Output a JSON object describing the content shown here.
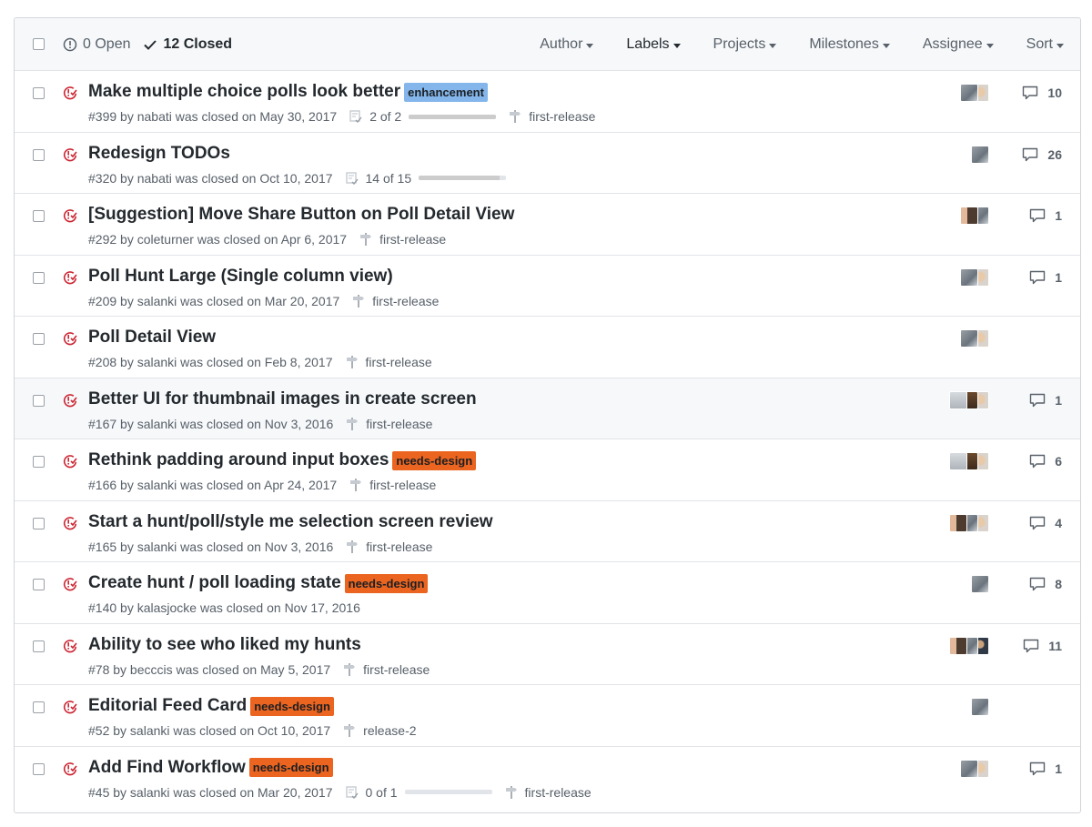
{
  "header": {
    "open_label": "0 Open",
    "closed_label": "12 Closed",
    "filters": [
      "Author",
      "Labels",
      "Projects",
      "Milestones",
      "Assignee",
      "Sort"
    ]
  },
  "colors": {
    "closed_icon": "#cb2431",
    "label_enhancement": "#84b6eb",
    "label_needs_design": "#eb6420"
  },
  "issues": [
    {
      "title": "Make multiple choice polls look better",
      "label": "enhancement",
      "meta": "#399 by nabati was closed on May 30, 2017",
      "tasks": "2 of 2",
      "task_progress": 1.0,
      "milestone": "first-release",
      "comments": "10",
      "avatars": [
        "avatar-gray",
        "avatar-glasses"
      ]
    },
    {
      "title": "Redesign TODOs",
      "label": "",
      "meta": "#320 by nabati was closed on Oct 10, 2017",
      "tasks": "14 of 15",
      "task_progress": 0.93,
      "milestone": "",
      "comments": "26",
      "avatars": [
        "avatar-gray"
      ]
    },
    {
      "title": "[Suggestion] Move Share Button on Poll Detail View",
      "label": "",
      "meta": "#292 by coleturner was closed on Apr 6, 2017",
      "tasks": "",
      "task_progress": 0,
      "milestone": "first-release",
      "comments": "1",
      "avatars": [
        "avatar-face",
        "avatar-gray"
      ]
    },
    {
      "title": "Poll Hunt Large (Single column view)",
      "label": "",
      "meta": "#209 by salanki was closed on Mar 20, 2017",
      "tasks": "",
      "task_progress": 0,
      "milestone": "first-release",
      "comments": "1",
      "avatars": [
        "avatar-gray",
        "avatar-glasses"
      ]
    },
    {
      "title": "Poll Detail View",
      "label": "",
      "meta": "#208 by salanki was closed on Feb 8, 2017",
      "tasks": "",
      "task_progress": 0,
      "milestone": "first-release",
      "comments": "",
      "avatars": [
        "avatar-gray",
        "avatar-glasses"
      ]
    },
    {
      "title": "Better UI for thumbnail images in create screen",
      "label": "",
      "meta": "#167 by salanki was closed on Nov 3, 2016",
      "tasks": "",
      "task_progress": 0,
      "milestone": "first-release",
      "comments": "1",
      "avatars": [
        "avatar-light",
        "avatar-brown",
        "avatar-glasses"
      ]
    },
    {
      "title": "Rethink padding around input boxes",
      "label": "needs-design",
      "meta": "#166 by salanki was closed on Apr 24, 2017",
      "tasks": "",
      "task_progress": 0,
      "milestone": "first-release",
      "comments": "6",
      "avatars": [
        "avatar-light",
        "avatar-brown",
        "avatar-glasses"
      ]
    },
    {
      "title": "Start a hunt/poll/style me selection screen review",
      "label": "",
      "meta": "#165 by salanki was closed on Nov 3, 2016",
      "tasks": "",
      "task_progress": 0,
      "milestone": "first-release",
      "comments": "4",
      "avatars": [
        "avatar-face",
        "avatar-gray",
        "avatar-glasses"
      ]
    },
    {
      "title": "Create hunt / poll loading state",
      "label": "needs-design",
      "meta": "#140 by kalasjocke was closed on Nov 17, 2016",
      "tasks": "",
      "task_progress": 0,
      "milestone": "",
      "comments": "8",
      "avatars": [
        "avatar-gray"
      ]
    },
    {
      "title": "Ability to see who liked my hunts",
      "label": "",
      "meta": "#78 by becccis was closed on May 5, 2017",
      "tasks": "",
      "task_progress": 0,
      "milestone": "first-release",
      "comments": "11",
      "avatars": [
        "avatar-face",
        "avatar-gray",
        "avatar-beard"
      ]
    },
    {
      "title": "Editorial Feed Card",
      "label": "needs-design",
      "meta": "#52 by salanki was closed on Oct 10, 2017",
      "tasks": "",
      "task_progress": 0,
      "milestone": "release-2",
      "comments": "",
      "avatars": [
        "avatar-gray"
      ]
    },
    {
      "title": "Add Find Workflow",
      "label": "needs-design",
      "meta": "#45 by salanki was closed on Mar 20, 2017",
      "tasks": "0 of 1",
      "task_progress": 0.0,
      "milestone": "first-release",
      "comments": "1",
      "avatars": [
        "avatar-gray",
        "avatar-glasses"
      ]
    }
  ]
}
